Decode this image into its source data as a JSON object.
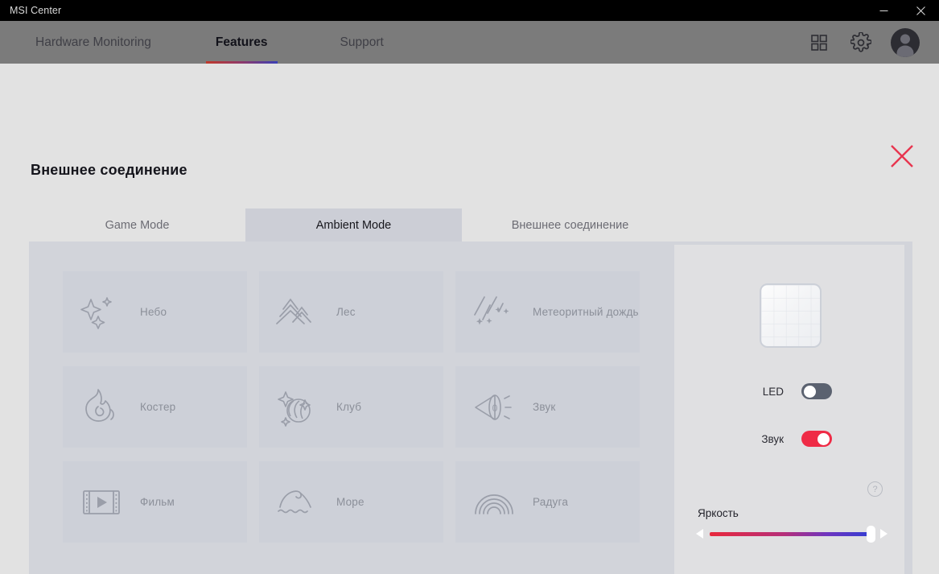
{
  "window": {
    "title": "MSI Center",
    "minimize_label": "minimize",
    "close_label": "close"
  },
  "nav": {
    "items": [
      {
        "label": "Hardware Monitoring",
        "active": false
      },
      {
        "label": "Features",
        "active": true
      },
      {
        "label": "Support",
        "active": false
      }
    ],
    "icons": [
      {
        "name": "apps-grid-icon"
      },
      {
        "name": "gear-icon"
      },
      {
        "name": "user-avatar"
      }
    ],
    "accent_gradient_from": "#c0392b",
    "accent_gradient_to": "#3b40b5"
  },
  "page": {
    "title": "Внешнее соединение",
    "close_icon_color": "#e8354f"
  },
  "tabs": [
    {
      "label": "Game Mode",
      "active": false
    },
    {
      "label": "Ambient Mode",
      "active": true
    },
    {
      "label": "Внешнее соединение",
      "active": false
    }
  ],
  "effects": [
    {
      "label": "Небо",
      "icon": "sparkles-icon"
    },
    {
      "label": "Лес",
      "icon": "pine-trees-icon"
    },
    {
      "label": "Метеоритный дождь",
      "icon": "meteor-shower-icon"
    },
    {
      "label": "Костер",
      "icon": "flame-icon"
    },
    {
      "label": "Клуб",
      "icon": "disco-moon-icon"
    },
    {
      "label": "Звук",
      "icon": "speaker-icon"
    },
    {
      "label": "Фильм",
      "icon": "film-play-icon"
    },
    {
      "label": "Море",
      "icon": "wave-icon"
    },
    {
      "label": "Радуга",
      "icon": "rainbow-icon"
    }
  ],
  "settings": {
    "preview_name": "led-preview",
    "led": {
      "label": "LED",
      "state": "off"
    },
    "sound": {
      "label": "Звук",
      "state": "on"
    },
    "help": {
      "glyph": "?"
    },
    "brightness": {
      "label": "Яркость",
      "value": 100,
      "gradient_from": "#e8283c",
      "gradient_to": "#2f3fd4",
      "decrease_glyph": "◀",
      "increase_glyph": "▶"
    },
    "toggle_on_color": "#ef2b46",
    "toggle_off_color": "#5b6270"
  }
}
